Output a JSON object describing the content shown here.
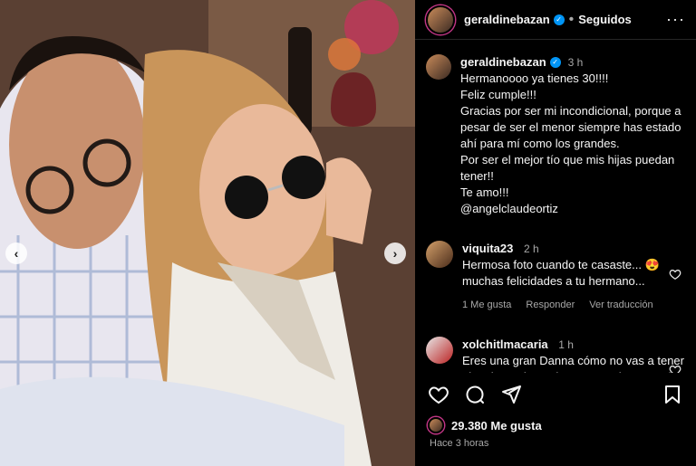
{
  "header": {
    "username": "geraldinebazan",
    "follow_state": "Seguidos",
    "more_icon": "more-horizontal-icon"
  },
  "caption": {
    "username": "geraldinebazan",
    "time": "3 h",
    "lines": [
      "Hermanoooo ya tienes 30!!!!",
      "Feliz cumple!!!",
      "Gracias por ser mi incondicional, porque a pesar de ser el menor siempre has estado ahí para mí como los grandes.",
      "Por ser el mejor tío que mis hijas puedan tener!!",
      "Te amo!!!",
      "@angelclaudeortiz"
    ]
  },
  "comments": [
    {
      "username": "viquita23",
      "time": "2 h",
      "text": "Hermosa foto cuando te casaste... 😍 muchas felicidades a tu hermano...",
      "likes": "1 Me gusta",
      "reply": "Responder",
      "translate": "Ver traducción"
    },
    {
      "username": "xolchitlmacaria",
      "time": "1 h",
      "text": "Eres una gran Danna cómo no vas a tener el mejor amigo tu hermana tu hermano los quiero mucho"
    }
  ],
  "footer": {
    "likes_count": "29.380 Me gusta",
    "posted": "Hace 3 horas"
  },
  "colors": {
    "background": "#000000",
    "accent": "#0095f6",
    "muted": "#a8a8a8"
  }
}
